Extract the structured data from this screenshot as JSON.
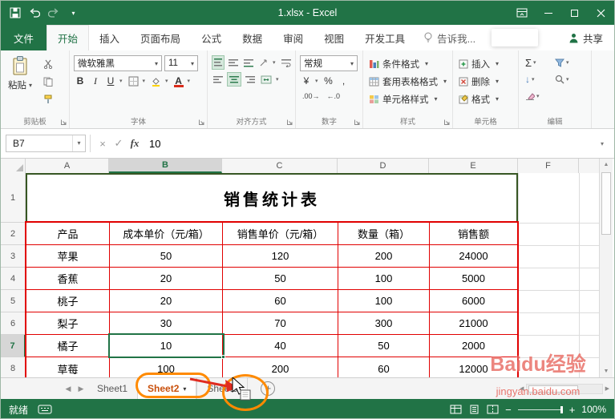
{
  "titlebar": {
    "title": "1.xlsx - Excel"
  },
  "tabs": {
    "file": "文件",
    "home": "开始",
    "insert": "插入",
    "layout": "页面布局",
    "formulas": "公式",
    "data": "数据",
    "review": "审阅",
    "view": "视图",
    "developer": "开发工具",
    "tellme": "告诉我...",
    "share": "共享"
  },
  "ribbon": {
    "paste": "粘贴",
    "clipboard": "剪贴板",
    "font_name": "微软雅黑",
    "font_size": "11",
    "font": "字体",
    "alignment": "对齐方式",
    "number_format": "常规",
    "number": "数字",
    "conditional_formatting": "条件格式",
    "format_as_table": "套用表格格式",
    "cell_styles": "单元格样式",
    "styles": "样式",
    "insert": "插入",
    "delete": "删除",
    "format": "格式",
    "cells": "单元格",
    "editing": "编辑"
  },
  "formula_bar": {
    "name_box": "B7",
    "fx": "fx",
    "value": "10"
  },
  "sheet": {
    "cols": [
      "A",
      "B",
      "C",
      "D",
      "E",
      "F"
    ],
    "rows": [
      "1",
      "2",
      "3",
      "4",
      "5",
      "6",
      "7",
      "8"
    ],
    "title": "销售统计表",
    "headers": [
      "产品",
      "成本单价（元/箱）",
      "销售单价（元/箱）",
      "数量（箱）",
      "销售额"
    ],
    "data": [
      [
        "苹果",
        "50",
        "120",
        "200",
        "24000"
      ],
      [
        "香蕉",
        "20",
        "50",
        "100",
        "5000"
      ],
      [
        "桃子",
        "20",
        "60",
        "100",
        "6000"
      ],
      [
        "梨子",
        "30",
        "70",
        "300",
        "21000"
      ],
      [
        "橘子",
        "10",
        "40",
        "50",
        "2000"
      ],
      [
        "草莓",
        "100",
        "200",
        "60",
        "12000"
      ]
    ]
  },
  "sheet_tabs": {
    "sheet1": "Sheet1",
    "sheet2": "Sheet2",
    "sheet3": "Sheet3"
  },
  "status": {
    "ready": "就绪",
    "zoom": "100%"
  },
  "watermark": {
    "line1": "Baidu经验",
    "line2": "jingyan.baidu.com"
  }
}
